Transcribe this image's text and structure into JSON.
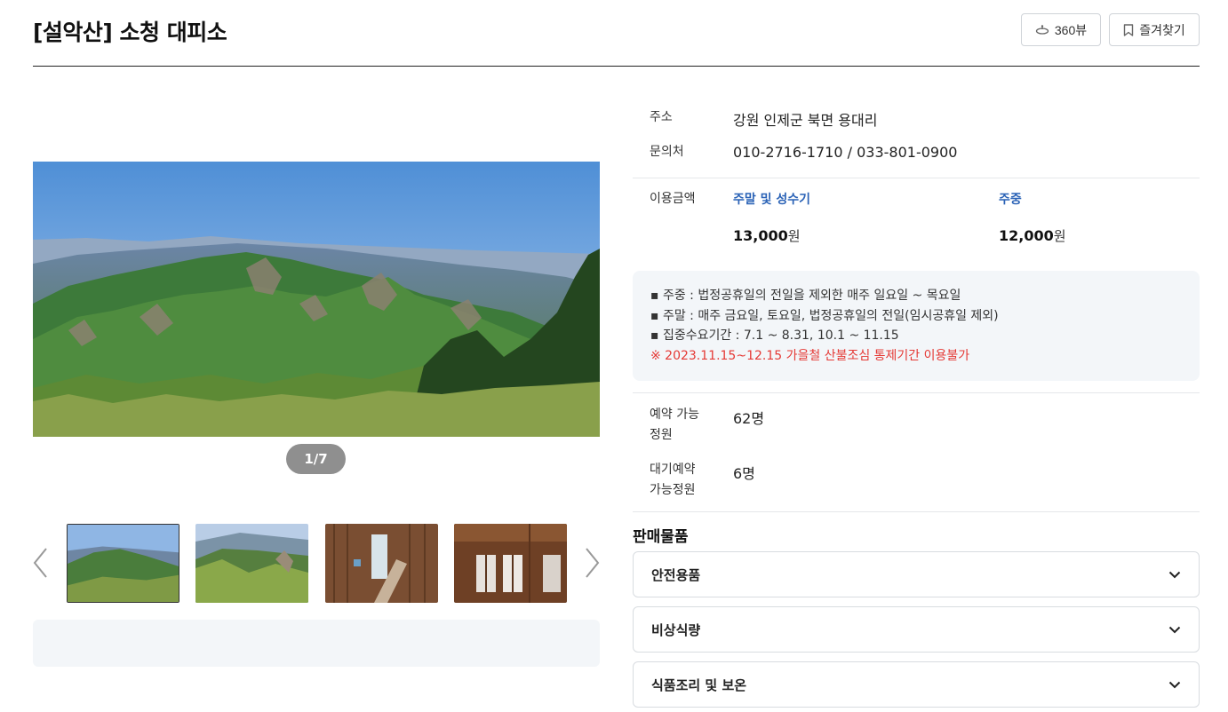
{
  "header": {
    "title": "[설악산] 소청 대피소",
    "view360_label": "360뷰",
    "favorite_label": "즐겨찾기"
  },
  "gallery": {
    "counter": "1/7",
    "thumbnails": [
      "mountain-view",
      "mountain-forest",
      "shelter-interior",
      "shelter-windows"
    ]
  },
  "info": {
    "address_label": "주소",
    "address": "강원 인제군 북면 용대리",
    "contact_label": "문의처",
    "contact": "010-2716-1710 / 033-801-0900",
    "fee_label": "이용금액",
    "fees": [
      {
        "period": "주말 및 성수기",
        "amount": "13,000",
        "unit": "원"
      },
      {
        "period": "주중",
        "amount": "12,000",
        "unit": "원"
      }
    ]
  },
  "notice": {
    "lines": [
      "주중 : 법정공휴일의 전일을 제외한 매주 일요일 ~ 목요일",
      "주말 : 매주 금요일, 토요일, 법정공휴일의 전일(임시공휴일 제외)",
      "집중수요기간 : 7.1 ~ 8.31, 10.1 ~ 11.15"
    ],
    "bullet": "▪",
    "warning": "※ 2023.11.15~12.15 가을철 산불조심 통제기간 이용불가"
  },
  "capacity": {
    "reservable_label_1": "예약 가능",
    "reservable_label_2": "정원",
    "reservable_value": "62명",
    "waitlist_label_1": "대기예약",
    "waitlist_label_2": "가능정원",
    "waitlist_value": "6명"
  },
  "products": {
    "title": "판매물품",
    "items": [
      "안전용품",
      "비상식량",
      "식품조리 및 보온"
    ]
  },
  "colors": {
    "accent": "#2a62b6",
    "warning": "#e53935",
    "panel": "#f3f6f9"
  }
}
